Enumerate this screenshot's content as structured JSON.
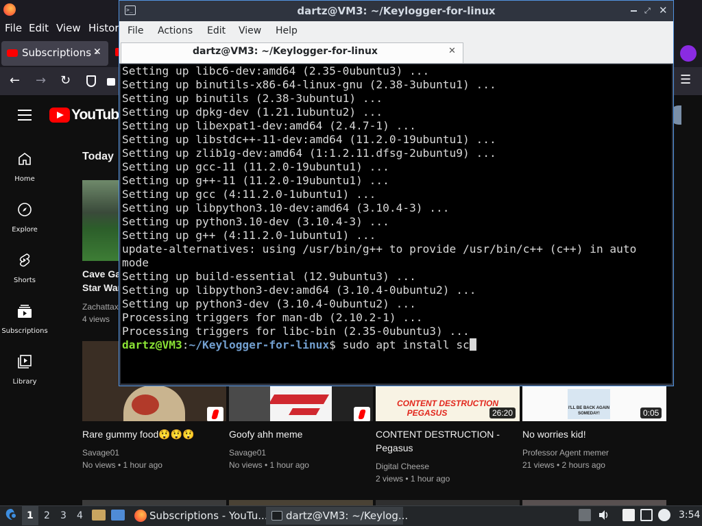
{
  "browser": {
    "menu": [
      "File",
      "Edit",
      "View",
      "History"
    ],
    "tab_title": "Subscriptions - YouTube",
    "tab_title_short": "Subscriptions -",
    "youtube_logo_text": "YouTube",
    "section_heading": "Today",
    "sidebar": [
      {
        "label": "Home",
        "icon": "home-icon"
      },
      {
        "label": "Explore",
        "icon": "compass-icon"
      },
      {
        "label": "Shorts",
        "icon": "shorts-icon"
      },
      {
        "label": "Subscriptions",
        "icon": "subscriptions-icon"
      },
      {
        "label": "Library",
        "icon": "library-icon"
      }
    ],
    "partial_video": {
      "title_line1": "Cave Ga",
      "title_line2": "Star War",
      "channel": "Zachattax",
      "meta": "4 views"
    },
    "videos": [
      {
        "title": "Rare gummy food😲😲😲",
        "channel": "Savage01",
        "meta": "No views • 1 hour ago",
        "badge": "shorts"
      },
      {
        "title": "Goofy ahh meme",
        "channel": "Savage01",
        "meta": "No views • 1 hour ago",
        "badge": "shorts"
      },
      {
        "title_line1": "CONTENT DESTRUCTION -",
        "title_line2": "Pegasus",
        "channel": "Digital Cheese",
        "meta": "2 views • 1 hour ago",
        "duration": "26:20",
        "thumb_text1": "CONTENT DESTRUCTION",
        "thumb_text2": "PEGASUS"
      },
      {
        "title": "No worries kid!",
        "channel": "Professor Agent memer",
        "meta": "21 views • 2 hours ago",
        "duration": "0:05",
        "thumb_text": "I'LL BE BACK AGAIN SOMEDAY!"
      }
    ]
  },
  "terminal": {
    "title": "dartz@VM3: ~/Keylogger-for-linux",
    "menu": [
      "File",
      "Actions",
      "Edit",
      "View",
      "Help"
    ],
    "tab_label": "dartz@VM3: ~/Keylogger-for-linux",
    "lines": [
      "Setting up libc6-dev:amd64 (2.35-0ubuntu3) ...",
      "Setting up binutils-x86-64-linux-gnu (2.38-3ubuntu1) ...",
      "Setting up binutils (2.38-3ubuntu1) ...",
      "Setting up dpkg-dev (1.21.1ubuntu2) ...",
      "Setting up libexpat1-dev:amd64 (2.4.7-1) ...",
      "Setting up libstdc++-11-dev:amd64 (11.2.0-19ubuntu1) ...",
      "Setting up zlib1g-dev:amd64 (1:1.2.11.dfsg-2ubuntu9) ...",
      "Setting up gcc-11 (11.2.0-19ubuntu1) ...",
      "Setting up g++-11 (11.2.0-19ubuntu1) ...",
      "Setting up gcc (4:11.2.0-1ubuntu1) ...",
      "Setting up libpython3.10-dev:amd64 (3.10.4-3) ...",
      "Setting up python3.10-dev (3.10.4-3) ...",
      "Setting up g++ (4:11.2.0-1ubuntu1) ...",
      "update-alternatives: using /usr/bin/g++ to provide /usr/bin/c++ (c++) in auto",
      "mode",
      "Setting up build-essential (12.9ubuntu3) ...",
      "Setting up libpython3-dev:amd64 (3.10.4-0ubuntu2) ...",
      "Setting up python3-dev (3.10.4-0ubuntu2) ...",
      "Processing triggers for man-db (2.10.2-1) ...",
      "Processing triggers for libc-bin (2.35-0ubuntu3) ..."
    ],
    "prompt": {
      "user_host": "dartz@VM3",
      "separator": ":",
      "path": "~/Keylogger-for-linux",
      "symbol": "$",
      "command": " sudo apt install sc"
    }
  },
  "taskbar": {
    "workspaces": [
      "1",
      "2",
      "3",
      "4"
    ],
    "active_workspace": "1",
    "tasks": [
      {
        "label": "Subscriptions - YouTu...",
        "icon": "firefox-icon"
      },
      {
        "label": "dartz@VM3: ~/Keylog...",
        "icon": "terminal-icon"
      }
    ],
    "clock": "3:54"
  }
}
